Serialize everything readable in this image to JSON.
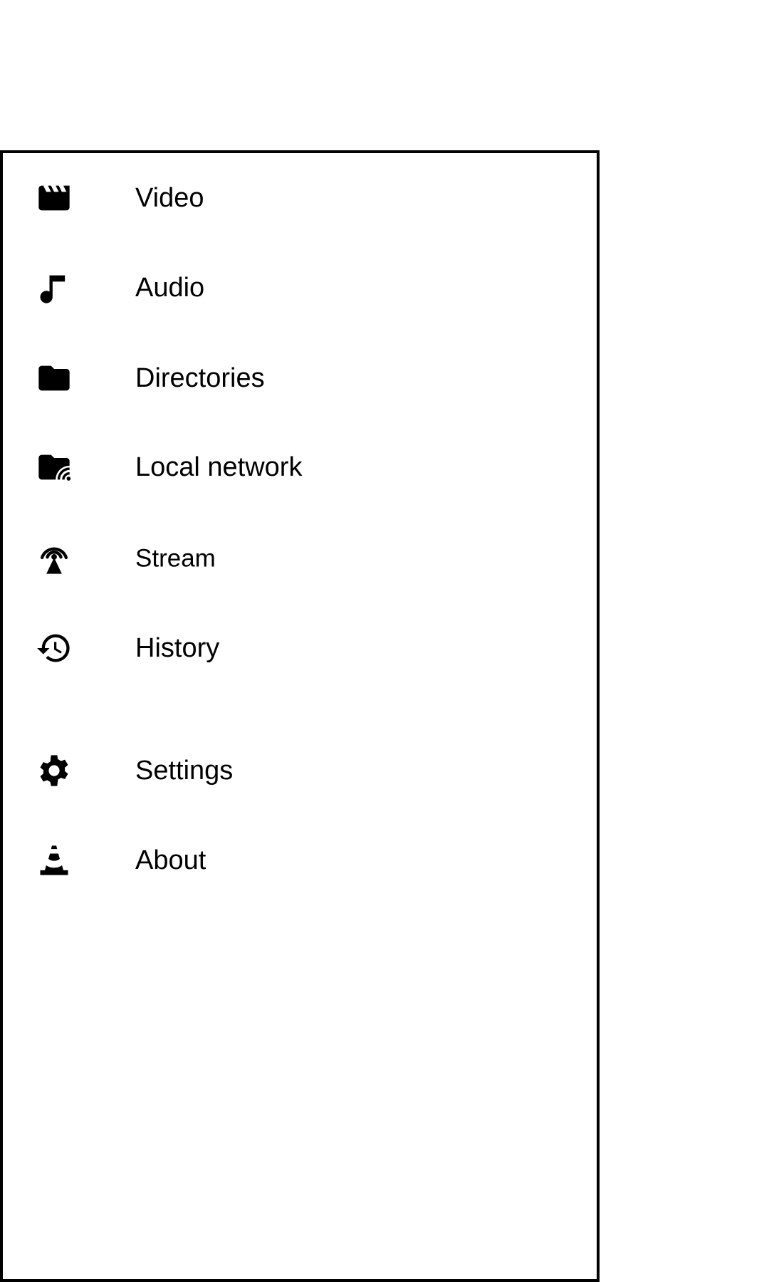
{
  "drawer": {
    "items": [
      {
        "label": "Video",
        "icon": "clapperboard-icon"
      },
      {
        "label": "Audio",
        "icon": "music-note-icon"
      },
      {
        "label": "Directories",
        "icon": "folder-icon"
      },
      {
        "label": "Local network",
        "icon": "network-folder-icon"
      },
      {
        "label": "Stream",
        "icon": "antenna-icon"
      },
      {
        "label": "History",
        "icon": "history-icon"
      }
    ],
    "secondary_items": [
      {
        "label": "Settings",
        "icon": "gear-icon"
      },
      {
        "label": "About",
        "icon": "traffic-cone-icon"
      }
    ]
  },
  "colors": {
    "text": "#000000",
    "background": "#ffffff",
    "border": "#000000"
  }
}
